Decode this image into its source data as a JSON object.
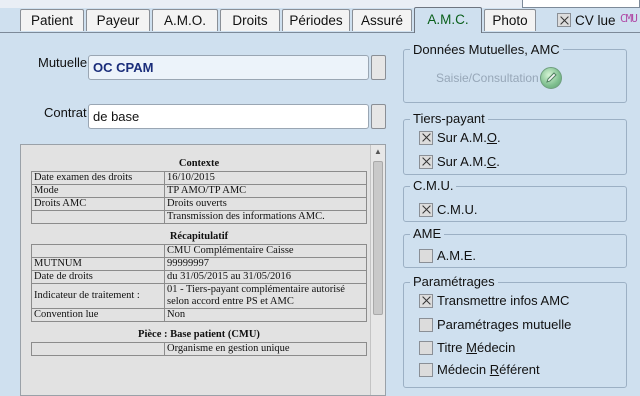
{
  "tabs": [
    {
      "label": "Patient"
    },
    {
      "label": "Payeur"
    },
    {
      "label": "A.M.O."
    },
    {
      "label": "Droits"
    },
    {
      "label": "Périodes"
    },
    {
      "label": "Assuré"
    },
    {
      "label": "A.M.C.",
      "active": true
    },
    {
      "label": "Photo"
    }
  ],
  "cv_lue": {
    "label": "CV lue",
    "checked": true
  },
  "cmu_tag": "CMU",
  "mutuelle": {
    "label": "Mutuelle",
    "value": "OC CPAM"
  },
  "contrat": {
    "label": "Contrat",
    "value": "de base"
  },
  "document": {
    "contexte": {
      "title": "Contexte",
      "rows": [
        [
          "Date examen des droits",
          "16/10/2015"
        ],
        [
          "Mode",
          "TP AMO/TP AMC"
        ],
        [
          "Droits AMC",
          "Droits ouverts"
        ],
        [
          "",
          "Transmission des informations AMC."
        ]
      ]
    },
    "recap": {
      "title": "Récapitulatif",
      "rows": [
        [
          "",
          "CMU Complémentaire Caisse"
        ],
        [
          "MUTNUM",
          "99999997"
        ],
        [
          "Date de droits",
          "du 31/05/2015 au 31/05/2016"
        ],
        [
          "Indicateur de traitement :",
          "01 - Tiers-payant complémentaire autorisé selon accord entre PS et AMC"
        ],
        [
          "Convention lue",
          "Non"
        ]
      ]
    },
    "piece": {
      "title": "Pièce : Base patient (CMU)",
      "rows": [
        [
          "",
          "Organisme en gestion unique"
        ]
      ]
    }
  },
  "donnees_mutuelles": {
    "title": "Données Mutuelles, AMC",
    "saisie_label": "Saisie/Consultation"
  },
  "tiers_payant": {
    "title": "Tiers-payant",
    "options": [
      {
        "label_pre": "Sur A.M.",
        "label_u": "O",
        "label_post": ".",
        "checked": true
      },
      {
        "label_pre": "Sur A.M.",
        "label_u": "C",
        "label_post": ".",
        "checked": true
      }
    ]
  },
  "cmu": {
    "title": "C.M.U.",
    "option": {
      "label": "C.M.U.",
      "checked": true
    }
  },
  "ame": {
    "title": "AME",
    "option": {
      "label": "A.M.E.",
      "checked": false
    }
  },
  "parametrages": {
    "title": "Paramétrages",
    "options": [
      {
        "label_pre": "Transmettre infos AMC",
        "label_u": "",
        "label_post": "",
        "checked": true
      },
      {
        "label_pre": "Paramétrages mutuelle",
        "label_u": "",
        "label_post": "",
        "checked": false
      },
      {
        "label_pre": "Titre ",
        "label_u": "M",
        "label_post": "édecin",
        "checked": false
      },
      {
        "label_pre": "Médecin ",
        "label_u": "R",
        "label_post": "éférent",
        "checked": false
      }
    ]
  }
}
